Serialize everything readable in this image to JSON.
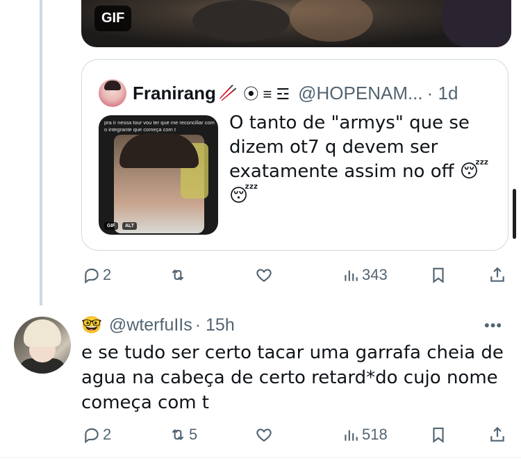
{
  "media": {
    "badge": "GIF"
  },
  "quote": {
    "name": "Franirang",
    "name_emoji": "🥢",
    "symbols": "⦿ ≡ ☲",
    "handle": "@HOPENAM...",
    "time": "· 1d",
    "thumb_caption": "pra ir nessa tour vou ter que me reconciliar com o integrante que começa com t",
    "thumb_gif_tag": "GIF",
    "thumb_alt_tag": "ALT",
    "text": "O tanto de \"armys\" que se dizem ot7 q devem ser exatamente assim no off 😴😴"
  },
  "quote_actions": {
    "reply_count": "2",
    "retweet_count": "",
    "views_count": "343"
  },
  "tweet": {
    "emoji": "🤓",
    "handle": "@wterfuIIs",
    "time": "· 15h",
    "more": "•••",
    "text": "e se tudo ser certo tacar uma garrafa cheia de agua na cabeça de certo retard*do cujo nome começa com t"
  },
  "tweet_actions": {
    "reply_count": "2",
    "retweet_count": "5",
    "views_count": "518"
  }
}
